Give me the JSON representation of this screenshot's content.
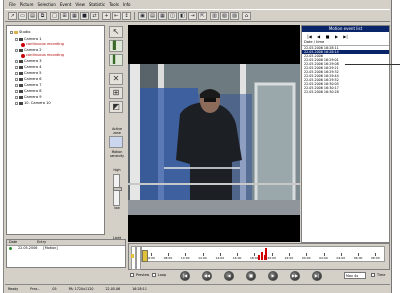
{
  "menu": [
    "File",
    "Picture",
    "Selection",
    "Event",
    "View",
    "Statistic",
    "Tools",
    "Info"
  ],
  "toolbar": {
    "icons": [
      "open-icon",
      "save-icon",
      "print-icon",
      "copy-icon",
      "layout-1-icon",
      "layout-4-icon",
      "layout-9-icon",
      "layout-16-icon",
      "flip-icon",
      "zoom-in-icon",
      "zoom-out-icon",
      "select-icon",
      "sep",
      "camera-icon",
      "grid-icon",
      "grid-alt-icon",
      "record-icon",
      "marker-icon",
      "cut-icon",
      "export-icon",
      "info-icon",
      "stats-icon",
      "stats-alt-icon",
      "help-icon"
    ]
  },
  "tree": {
    "root": "Studio",
    "items": [
      {
        "label": "Camera 1",
        "type": "camera"
      },
      {
        "label": "continuous recording",
        "type": "alarm"
      },
      {
        "label": "Camera 2",
        "type": "camera"
      },
      {
        "label": "continuous recording",
        "type": "alarm"
      },
      {
        "label": "Camera 3",
        "type": "camera"
      },
      {
        "label": "Camera 4",
        "type": "camera"
      },
      {
        "label": "Camera 5",
        "type": "camera"
      },
      {
        "label": "Camera 6",
        "type": "camera"
      },
      {
        "label": "Camera 7",
        "type": "camera"
      },
      {
        "label": "Camera 8",
        "type": "camera"
      },
      {
        "label": "Camera 9",
        "type": "camera"
      },
      {
        "label": "10. Camera 10",
        "type": "camera"
      }
    ]
  },
  "side": {
    "active_zone_label": "Active zone",
    "motion_label": "Motion sensivity",
    "high_label": "high",
    "low_label": "low",
    "light_label": "Light"
  },
  "events": {
    "title": "Motion event list",
    "nav": [
      "|◀",
      "◀",
      "■",
      "▶",
      "▶|"
    ],
    "header": "Date / time",
    "rows": [
      "22.05.2006   16:28:11",
      "22.05.2006   16:28:14",
      "22.05.2006",
      "22.05.2006   16:29:01",
      "22.05.2006   16:29:08",
      "22.05.2006   16:29:21",
      "22.05.2006   16:29:32",
      "22.05.2006   16:29:44",
      "22.05.2006   16:29:52",
      "22.05.2006   16:30:05",
      "22.05.2006   16:30:17",
      "22.05.2006   16:30:28"
    ],
    "selected_index": 1
  },
  "status_table": {
    "col1": "Date",
    "col2": "Entry",
    "row_date": "22.05.2006",
    "row_text": "[Motion]"
  },
  "timeline": {
    "ticks": [
      "06:00",
      "08:00",
      "10:00",
      "12:00",
      "14:00",
      "16:00",
      "18:00",
      "20:00",
      "22:00",
      "00:00",
      "02:00",
      "04:00",
      "06:00",
      "08:00"
    ],
    "events_pct": [
      0.48,
      0.49,
      0.505,
      0.51
    ]
  },
  "playback": {
    "preview_label": "Preview",
    "loop_label": "Loop",
    "speed_value": "Max 4x",
    "time_label": "Time",
    "buttons": [
      "|◀",
      "◀◀",
      "◀",
      "■",
      "▶",
      "▶▶",
      "▶|"
    ]
  },
  "statusbar": {
    "items": [
      "Ready",
      "Prez...",
      "05",
      "PA: 1720x1120",
      "22.05.06",
      "16:28:11"
    ]
  }
}
